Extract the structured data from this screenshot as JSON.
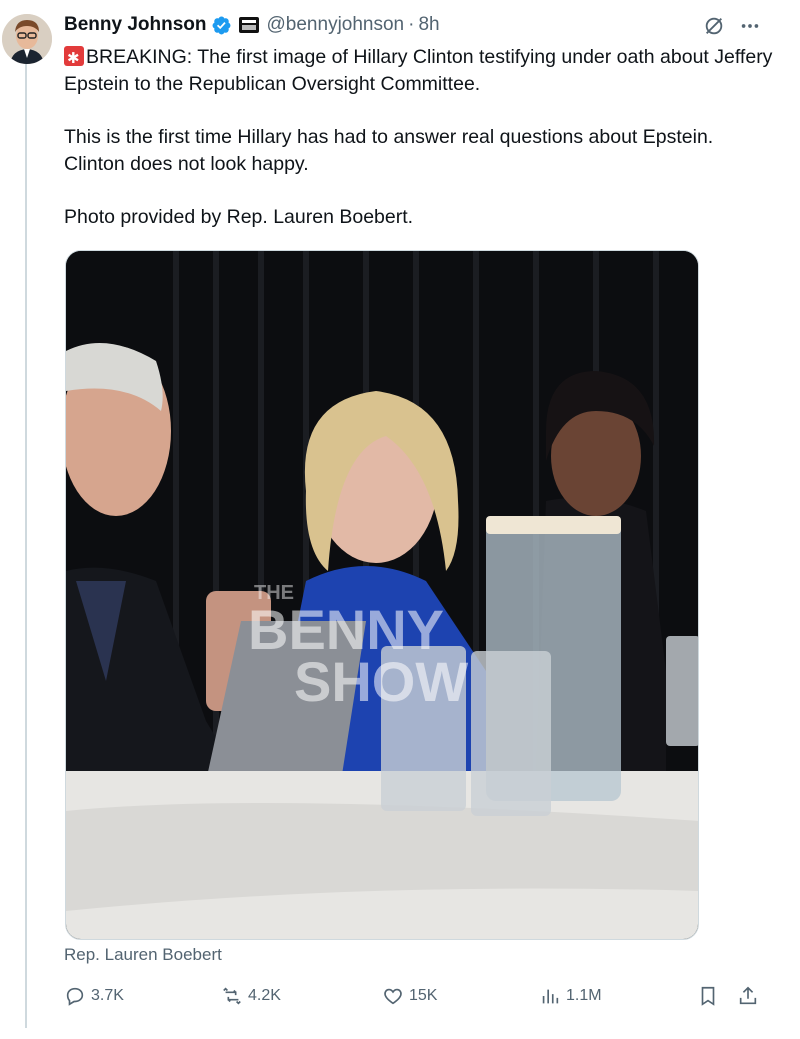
{
  "author": {
    "name": "Benny Johnson",
    "handle": "@bennyjohnson",
    "time": "8h"
  },
  "tweet": {
    "paragraph1": "BREAKING: The first image of Hillary Clinton testifying under oath about Jeffery Epstein to the Republican Oversight Committee.",
    "paragraph2": "This is the first time Hillary has had to answer real questions about Epstein. Clinton does not look happy.",
    "paragraph3": "Photo provided by Rep. Lauren Boebert."
  },
  "media": {
    "watermark_small": "THE",
    "watermark_line1": "BENNY",
    "watermark_line2": "SHOW",
    "caption": "Rep. Lauren Boebert"
  },
  "stats": {
    "replies": "3.7K",
    "reposts": "4.2K",
    "likes": "15K",
    "views": "1.1M"
  },
  "icons": [
    "verified-badge-icon",
    "affiliate-badge-icon",
    "grok-icon",
    "more-icon",
    "siren-emoji-icon",
    "reply-icon",
    "repost-icon",
    "like-icon",
    "views-icon",
    "bookmark-icon",
    "share-icon"
  ],
  "colors": {
    "text": "#0f1419",
    "secondary": "#536471",
    "verified": "#1d9bf0",
    "border": "#cfd9de"
  }
}
